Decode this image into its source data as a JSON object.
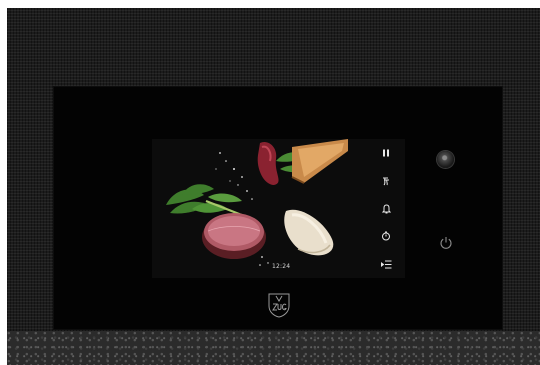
{
  "display": {
    "time": "12:24",
    "icons": [
      "pause-icon",
      "steam-icon",
      "bell-icon",
      "timer-icon",
      "menu-list-icon"
    ]
  },
  "controls": {
    "icons": [
      "rotary-knob",
      "power-icon"
    ]
  },
  "branding": {
    "logo_text": "V-ZUG"
  },
  "colors": {
    "panel": "#030303",
    "screen": "#0c0c0c",
    "meat": "#8c3a46",
    "herb": "#3d7a2a"
  }
}
